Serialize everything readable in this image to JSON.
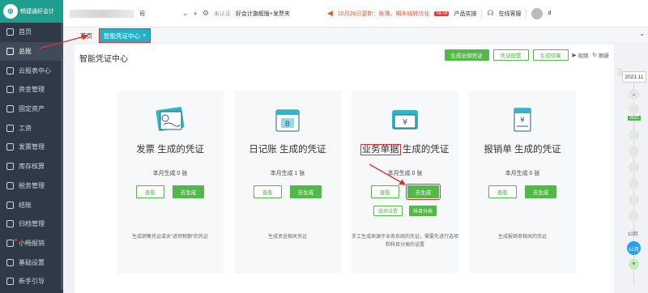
{
  "app": {
    "logo_text": "畅捷通好会计"
  },
  "sidebar": {
    "items": [
      {
        "label": "首页"
      },
      {
        "label": "总账"
      },
      {
        "label": "云报表中心"
      },
      {
        "label": "资金管理"
      },
      {
        "label": "固定资产"
      },
      {
        "label": "工资"
      },
      {
        "label": "发票管理"
      },
      {
        "label": "库存核算"
      },
      {
        "label": "税务管理"
      },
      {
        "label": "结账"
      },
      {
        "label": "归档管理"
      },
      {
        "label": "小畅报销"
      },
      {
        "label": "基础设置"
      },
      {
        "label": "新手引导"
      }
    ]
  },
  "topbar": {
    "company_suffix": "司",
    "cert_status": "未认证",
    "promo": "好会计旗舰版+发票夹",
    "notice": "10月26日更新：账簿、期末结转优化",
    "product_text": "产品实操",
    "service": "在线客服",
    "user_suffix": "d"
  },
  "tabs": {
    "home": "首页",
    "active": "智能凭证中心"
  },
  "content": {
    "title": "智能凭证中心",
    "buttons": {
      "generate_all": "生成全部凭证",
      "config": "凭证配置",
      "result": "生成结果",
      "video": "视频",
      "refresh": "刷新"
    },
    "cards": [
      {
        "title_a": "发票",
        "title_b": " 生成的凭证",
        "count": "本月生成 0 张",
        "view": "查看",
        "gen": "去生成",
        "desc": "生成销售凭证或含“进项税额”的凭证"
      },
      {
        "title_a": "日记账",
        "title_b": " 生成的凭证",
        "count": "本月生成 1 张",
        "view": "查看",
        "gen": "去生成",
        "desc": "生成资金相关凭证"
      },
      {
        "title_a": "业务单据",
        "title_b": " 生成的凭证",
        "count": "本月生成 0 张",
        "view": "查看",
        "gen": "去生成",
        "opt": "选项设置",
        "subj": "科目分类",
        "desc": "手工生成来源于业务系统的凭证，需要先进行选项和科目分类的设置"
      },
      {
        "title_a": "报销单",
        "title_b": " 生成的凭证",
        "count": "本月生成 0 张",
        "view": "查看",
        "gen": "去生成",
        "desc": "生成报销单相关的凭证"
      }
    ]
  },
  "timeline": {
    "year": "2021.11",
    "year_tag": "2021",
    "month_label": "10月",
    "active_month": "11月"
  }
}
